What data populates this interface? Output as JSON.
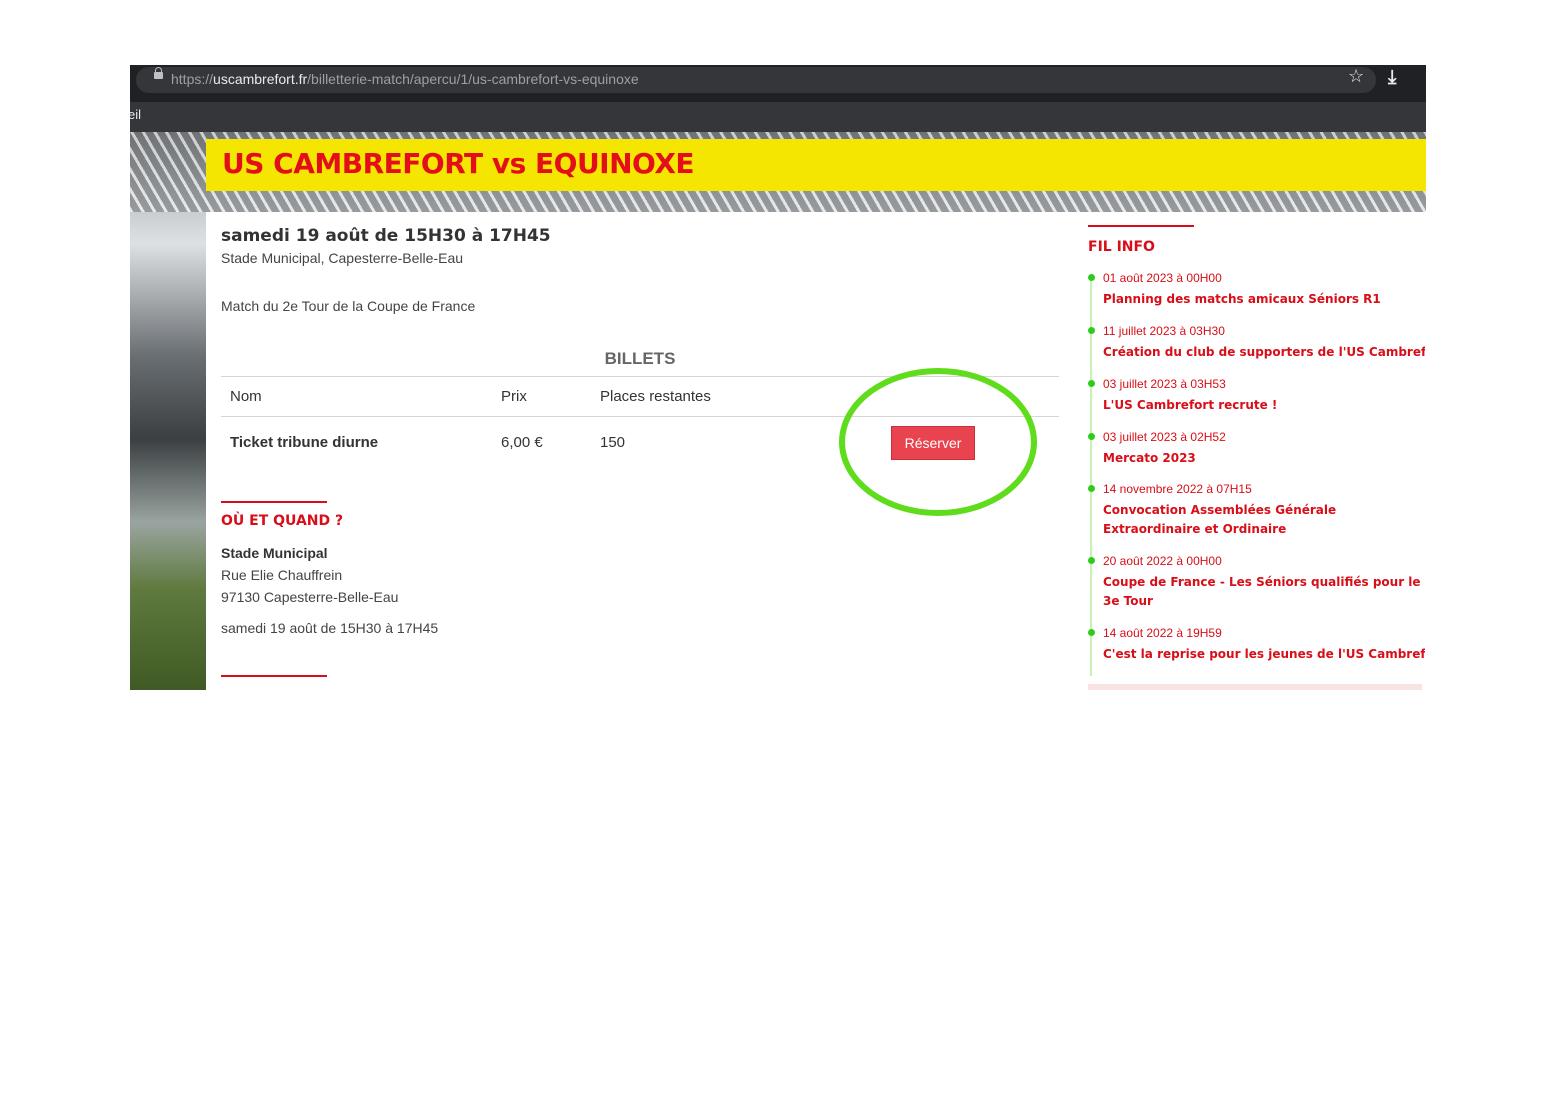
{
  "browser": {
    "url_scheme": "https://",
    "url_host": "uscambrefort.fr",
    "url_path": "/billetterie-match/apercu/1/us-cambrefort-vs-equinoxe",
    "bookmark_fragment": "eil"
  },
  "banner": {
    "title": "US CAMBREFORT vs EQUINOXE"
  },
  "event": {
    "date_time": "samedi 19 août de 15H30 à 17H45",
    "venue": "Stade Municipal, Capesterre-Belle-Eau",
    "description": "Match du 2e Tour de la Coupe de France"
  },
  "tickets": {
    "title": "BILLETS",
    "headers": [
      "Nom",
      "Prix",
      "Places restantes"
    ],
    "rows": [
      {
        "name": "Ticket tribune diurne",
        "price": "6,00 €",
        "remaining": "150",
        "button": "Réserver"
      }
    ]
  },
  "where_when": {
    "heading": "OÙ ET QUAND ?",
    "place": "Stade Municipal",
    "street": "Rue Elie Chauffrein",
    "city": "97130 Capesterre-Belle-Eau",
    "schedule": "samedi 19 août de 15H30 à 17H45"
  },
  "fil_info": {
    "heading": "FIL INFO",
    "items": [
      {
        "date": "01 août 2023 à 00H00",
        "title": "Planning des matchs amicaux Séniors R1"
      },
      {
        "date": "11 juillet 2023 à 03H30",
        "title": "Création du club de supporters de l'US Cambrefort"
      },
      {
        "date": "03 juillet 2023 à 03H53",
        "title": "L'US Cambrefort recrute !"
      },
      {
        "date": "03 juillet 2023 à 02H52",
        "title": "Mercato 2023"
      },
      {
        "date": "14 novembre 2022 à 07H15",
        "title": "Convocation Assemblées Générale Extraordinaire et Ordinaire"
      },
      {
        "date": "20 août 2022 à 00H00",
        "title": "Coupe de France - Les Séniors qualifiés pour le 3e Tour"
      },
      {
        "date": "14 août 2022 à 19H59",
        "title": "C'est la reprise pour les jeunes de l'US Cambrefort"
      }
    ]
  },
  "colors": {
    "banner": "#f4e600",
    "accent_red": "#d80e18",
    "button": "#e9434f",
    "highlight": "#5fdc1b"
  }
}
